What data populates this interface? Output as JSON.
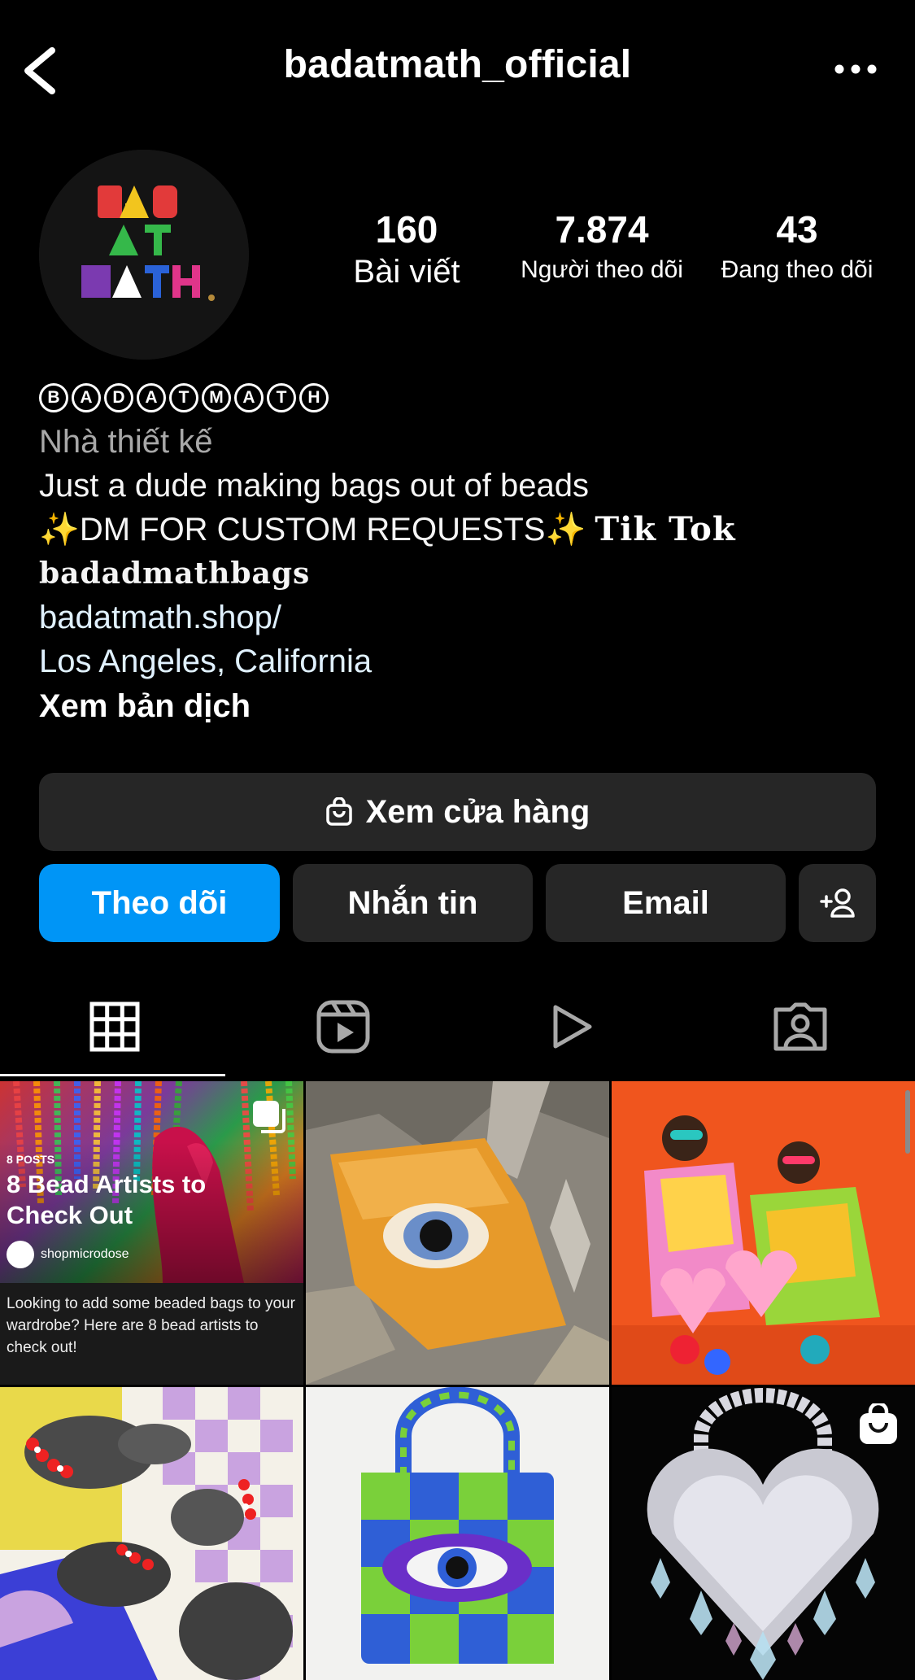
{
  "header": {
    "title": "badatmath_official"
  },
  "profile": {
    "avatar_lines": [
      "BAD",
      "AT",
      "MATH"
    ],
    "stats": [
      {
        "value": "160",
        "label": "Bài viết"
      },
      {
        "value": "7.874",
        "label": "Người theo dõi"
      },
      {
        "value": "43",
        "label": "Đang theo dõi"
      }
    ],
    "display_name_letters": [
      "B",
      "A",
      "D",
      "A",
      "T",
      "M",
      "A",
      "T",
      "H"
    ],
    "category": "Nhà thiết kế",
    "bio_line1": "Just a dude making bags out of beads",
    "bio_line2_sparkle": "✨",
    "bio_line2_text": "DM FOR CUSTOM REQUESTS",
    "bio_line2_tiktok": "Tik Tok",
    "bio_line3": "badadmathbags",
    "website": "badatmath.shop/",
    "location": "Los Angeles, California",
    "translate": "Xem bản dịch"
  },
  "actions": {
    "shop": "Xem cửa hàng",
    "follow": "Theo dõi",
    "message": "Nhắn tin",
    "email": "Email"
  },
  "tabs": [
    "grid-icon",
    "reels-icon",
    "video-icon",
    "tagged-icon"
  ],
  "grid": {
    "guide": {
      "count": "8 POSTS",
      "title": "8 Bead Artists to Check Out",
      "author": "shopmicrodose",
      "description": "Looking to add some beaded bags to your wardrobe? Here are 8 bead artists to check out!"
    }
  },
  "colors": {
    "background": "#000000",
    "button": "#262626",
    "accent": "#0095f6",
    "secondary_text": "#a8a8a8",
    "link": "#e0f1ff"
  }
}
